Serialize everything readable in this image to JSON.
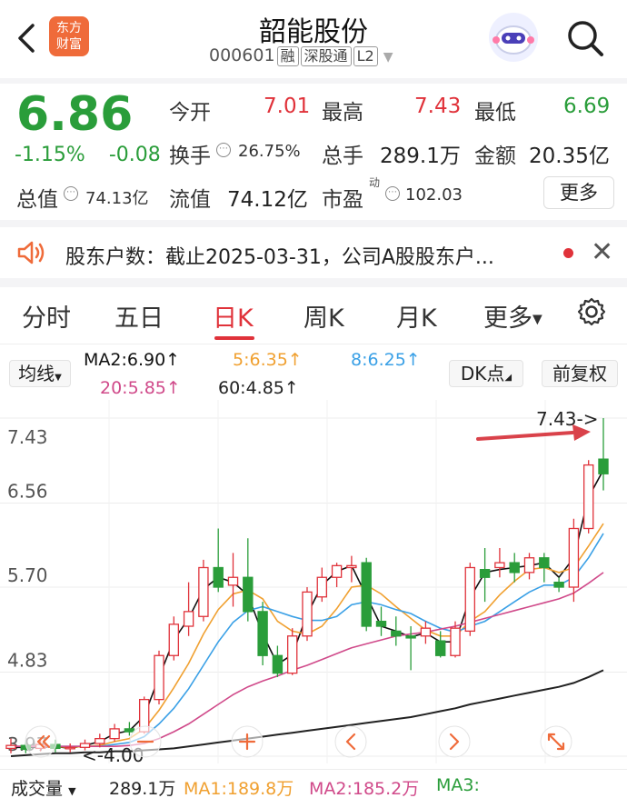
{
  "header": {
    "logo_line1": "东方",
    "logo_line2": "财富",
    "stock_name": "韶能股份",
    "stock_code": "000601",
    "tags": [
      "融",
      "深股通",
      "L2"
    ]
  },
  "quote": {
    "price": "6.86",
    "change_pct": "-1.15%",
    "change_amt": "-0.08",
    "open_label": "今开",
    "open_value": "7.01",
    "high_label": "最高",
    "high_value": "7.43",
    "low_label": "最低",
    "low_value": "6.69",
    "turnover_label": "换手",
    "turnover_value": "26.75%",
    "volume_label": "总手",
    "volume_value": "289.1万",
    "amount_label": "金额",
    "amount_value": "20.35亿",
    "mktcap_label": "总值",
    "mktcap_value": "74.13亿",
    "float_label": "流值",
    "float_value": "74.12亿",
    "pe_label": "市盈",
    "pe_sup": "动",
    "pe_value": "102.03",
    "more_label": "更多"
  },
  "notice": {
    "text": "股东户数：截止2025-03-31，公司A股股东户..."
  },
  "tabs": [
    {
      "label": "分时",
      "active": false
    },
    {
      "label": "五日",
      "active": false
    },
    {
      "label": "日K",
      "active": true
    },
    {
      "label": "周K",
      "active": false
    },
    {
      "label": "月K",
      "active": false
    },
    {
      "label": "更多",
      "active": false
    }
  ],
  "ma_legend": {
    "mode_label": "均线",
    "ma2": "MA2:6.90↑",
    "ma5": "5:6.35↑",
    "ma8": "8:6.25↑",
    "ma20": "20:5.85↑",
    "ma60": "60:4.85↑",
    "dk_label": "DK点",
    "adjust_label": "前复权"
  },
  "chart_data": {
    "type": "candlestick",
    "y_ticks": [
      "7.43",
      "6.56",
      "5.70",
      "4.83",
      "3.97"
    ],
    "ylim": [
      3.97,
      7.43
    ],
    "high_annotation": "7.43->",
    "low_annotation": "<-4.00",
    "candles": [
      {
        "o": 4.05,
        "c": 4.08,
        "h": 4.15,
        "l": 4.0
      },
      {
        "o": 4.08,
        "c": 4.04,
        "h": 4.12,
        "l": 4.0
      },
      {
        "o": 4.05,
        "c": 4.09,
        "h": 4.13,
        "l": 4.02
      },
      {
        "o": 4.09,
        "c": 4.05,
        "h": 4.14,
        "l": 4.01
      },
      {
        "o": 4.05,
        "c": 4.06,
        "h": 4.1,
        "l": 4.01
      },
      {
        "o": 4.06,
        "c": 4.1,
        "h": 4.14,
        "l": 4.03
      },
      {
        "o": 4.1,
        "c": 4.15,
        "h": 4.2,
        "l": 4.06
      },
      {
        "o": 4.15,
        "c": 4.25,
        "h": 4.3,
        "l": 4.12
      },
      {
        "o": 4.25,
        "c": 4.22,
        "h": 4.32,
        "l": 4.18
      },
      {
        "o": 4.22,
        "c": 4.55,
        "h": 4.58,
        "l": 4.2
      },
      {
        "o": 4.55,
        "c": 5.0,
        "h": 5.05,
        "l": 4.5
      },
      {
        "o": 5.0,
        "c": 5.32,
        "h": 5.4,
        "l": 4.95
      },
      {
        "o": 5.3,
        "c": 5.45,
        "h": 5.75,
        "l": 5.2
      },
      {
        "o": 5.4,
        "c": 5.9,
        "h": 5.98,
        "l": 5.35
      },
      {
        "o": 5.9,
        "c": 5.7,
        "h": 6.3,
        "l": 5.65
      },
      {
        "o": 5.72,
        "c": 5.8,
        "h": 6.05,
        "l": 5.5
      },
      {
        "o": 5.8,
        "c": 5.45,
        "h": 6.2,
        "l": 5.35
      },
      {
        "o": 5.45,
        "c": 5.0,
        "h": 5.55,
        "l": 4.9
      },
      {
        "o": 5.0,
        "c": 4.82,
        "h": 5.1,
        "l": 4.78
      },
      {
        "o": 4.82,
        "c": 5.2,
        "h": 5.28,
        "l": 4.8
      },
      {
        "o": 5.2,
        "c": 5.65,
        "h": 5.7,
        "l": 5.15
      },
      {
        "o": 5.6,
        "c": 5.8,
        "h": 5.9,
        "l": 5.55
      },
      {
        "o": 5.8,
        "c": 5.92,
        "h": 5.95,
        "l": 5.7
      },
      {
        "o": 5.9,
        "c": 5.92,
        "h": 6.02,
        "l": 5.75
      },
      {
        "o": 5.95,
        "c": 5.3,
        "h": 6.0,
        "l": 5.25
      },
      {
        "o": 5.35,
        "c": 5.3,
        "h": 5.5,
        "l": 5.2
      },
      {
        "o": 5.25,
        "c": 5.2,
        "h": 5.4,
        "l": 5.1
      },
      {
        "o": 5.2,
        "c": 5.18,
        "h": 5.3,
        "l": 4.85
      },
      {
        "o": 5.2,
        "c": 5.28,
        "h": 5.35,
        "l": 5.12
      },
      {
        "o": 5.15,
        "c": 5.0,
        "h": 5.25,
        "l": 4.98
      },
      {
        "o": 5.0,
        "c": 5.28,
        "h": 5.35,
        "l": 4.98
      },
      {
        "o": 5.25,
        "c": 5.9,
        "h": 5.95,
        "l": 5.2
      },
      {
        "o": 5.88,
        "c": 5.8,
        "h": 6.1,
        "l": 5.55
      },
      {
        "o": 5.9,
        "c": 5.95,
        "h": 6.1,
        "l": 5.8
      },
      {
        "o": 5.95,
        "c": 5.85,
        "h": 6.05,
        "l": 5.75
      },
      {
        "o": 5.85,
        "c": 6.0,
        "h": 6.05,
        "l": 5.78
      },
      {
        "o": 6.0,
        "c": 5.9,
        "h": 6.05,
        "l": 5.75
      },
      {
        "o": 5.75,
        "c": 5.7,
        "h": 5.8,
        "l": 5.65
      },
      {
        "o": 5.7,
        "c": 6.3,
        "h": 6.4,
        "l": 5.55
      },
      {
        "o": 6.3,
        "c": 6.95,
        "h": 7.0,
        "l": 6.25
      },
      {
        "o": 7.01,
        "c": 6.86,
        "h": 7.43,
        "l": 6.69
      }
    ],
    "ma_lines": [
      {
        "name": "MA2",
        "color": "#111111",
        "values": [
          4.06,
          4.06,
          4.06,
          4.07,
          4.05,
          4.08,
          4.12,
          4.2,
          4.23,
          4.38,
          4.78,
          5.16,
          5.38,
          5.68,
          5.8,
          5.75,
          5.62,
          5.22,
          4.91,
          5.01,
          5.42,
          5.72,
          5.86,
          5.92,
          5.61,
          5.3,
          5.25,
          5.19,
          5.23,
          5.14,
          5.14,
          5.59,
          5.85,
          5.88,
          5.9,
          5.92,
          5.95,
          5.8,
          6.0,
          6.62,
          6.9
        ]
      },
      {
        "name": "MA5",
        "color": "#f0a030",
        "values": [
          4.07,
          4.07,
          4.07,
          4.07,
          4.06,
          4.07,
          4.08,
          4.12,
          4.15,
          4.25,
          4.44,
          4.67,
          4.92,
          5.22,
          5.47,
          5.63,
          5.67,
          5.58,
          5.35,
          5.25,
          5.22,
          5.3,
          5.48,
          5.7,
          5.72,
          5.63,
          5.5,
          5.38,
          5.26,
          5.2,
          5.2,
          5.35,
          5.45,
          5.62,
          5.76,
          5.88,
          5.9,
          5.85,
          5.9,
          6.12,
          6.35
        ]
      },
      {
        "name": "MA8",
        "color": "#3aa0e6",
        "values": [
          4.07,
          4.07,
          4.07,
          4.07,
          4.07,
          4.07,
          4.07,
          4.09,
          4.11,
          4.17,
          4.3,
          4.46,
          4.66,
          4.9,
          5.14,
          5.34,
          5.46,
          5.5,
          5.45,
          5.4,
          5.36,
          5.36,
          5.4,
          5.52,
          5.55,
          5.52,
          5.47,
          5.43,
          5.35,
          5.28,
          5.24,
          5.3,
          5.35,
          5.45,
          5.55,
          5.65,
          5.72,
          5.72,
          5.8,
          6.0,
          6.25
        ]
      },
      {
        "name": "MA20",
        "color": "#d04a8a",
        "values": [
          4.07,
          4.07,
          4.07,
          4.07,
          4.07,
          4.07,
          4.07,
          4.07,
          4.08,
          4.1,
          4.15,
          4.22,
          4.3,
          4.4,
          4.5,
          4.6,
          4.68,
          4.74,
          4.79,
          4.85,
          4.9,
          4.96,
          5.02,
          5.08,
          5.12,
          5.16,
          5.2,
          5.22,
          5.24,
          5.27,
          5.3,
          5.34,
          5.38,
          5.42,
          5.46,
          5.5,
          5.54,
          5.58,
          5.64,
          5.74,
          5.85
        ]
      },
      {
        "name": "MA60",
        "color": "#222222",
        "values": [
          3.97,
          3.98,
          3.99,
          4.0,
          4.0,
          4.01,
          4.01,
          4.02,
          4.02,
          4.03,
          4.04,
          4.05,
          4.07,
          4.09,
          4.11,
          4.13,
          4.15,
          4.17,
          4.19,
          4.21,
          4.23,
          4.25,
          4.27,
          4.29,
          4.31,
          4.33,
          4.35,
          4.37,
          4.4,
          4.43,
          4.46,
          4.5,
          4.53,
          4.56,
          4.59,
          4.62,
          4.65,
          4.68,
          4.72,
          4.78,
          4.85
        ]
      }
    ]
  },
  "volume_bar": {
    "label": "成交量",
    "total": "289.1万",
    "ma1": "MA1:189.8万",
    "ma2": "MA2:185.2万",
    "ma3": "MA3:"
  },
  "colors": {
    "up": "#e0323a",
    "down": "#2a9d3a",
    "accent": "#e0323a"
  }
}
